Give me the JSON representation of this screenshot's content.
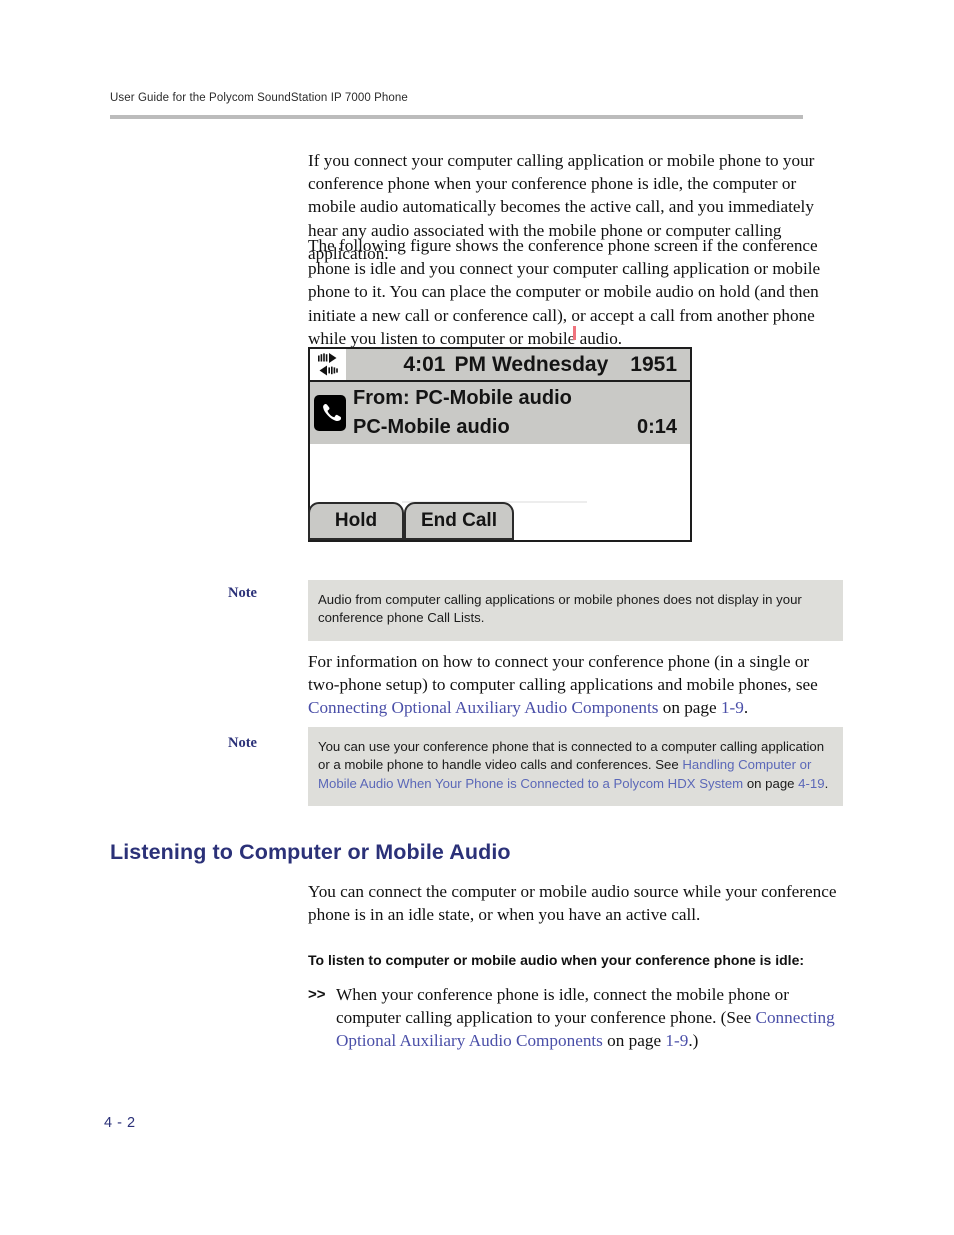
{
  "header": {
    "running_title": "User Guide for the Polycom SoundStation IP 7000 Phone"
  },
  "body": {
    "paragraph_1": "If you connect your computer calling application or mobile phone to your conference phone when your conference phone is idle, the computer or mobile audio automatically becomes the active call, and you immediately hear any audio associated with the mobile phone or computer calling application.",
    "paragraph_2": "The following figure shows the conference phone screen if the conference phone is idle and you connect your computer calling application or mobile phone to it. You can place the computer or mobile audio on hold (and then initiate a new call or conference call), or accept a call from another phone while you listen to computer or mobile audio.",
    "paragraph_3_pre": "For information on how to connect your conference phone (in a single or two-phone setup) to computer calling applications and mobile phones, see ",
    "paragraph_3_link": "Connecting Optional Auxiliary Audio Components",
    "paragraph_3_mid": " on page ",
    "paragraph_3_page": "1-9",
    "paragraph_3_post": ".",
    "paragraph_4": "You can connect the computer or mobile audio source while your conference phone is in an idle state, or when you have an active call."
  },
  "figure": {
    "status_bar": {
      "icon": "speaker-audio-icon",
      "time": "4:01",
      "ampm": "PM",
      "day": "Wednesday",
      "extension": "1951"
    },
    "call": {
      "icon": "handset-icon",
      "from_line": "From: PC-Mobile audio",
      "name_line": "PC-Mobile audio",
      "duration": "0:14"
    },
    "softkeys": [
      {
        "label": "Hold"
      },
      {
        "label": "End Call"
      }
    ]
  },
  "note_1": {
    "label": "Note",
    "text": "Audio from computer calling applications or mobile phones does not display in your conference phone Call Lists."
  },
  "note_2": {
    "label": "Note",
    "text_pre": "You can use your conference phone that is connected to a computer calling application or a mobile phone to handle video calls and conferences. See ",
    "link": "Handling Computer or Mobile Audio When Your Phone is Connected to a Polycom HDX System",
    "text_mid": " on page ",
    "page": "4-19",
    "text_post": "."
  },
  "section": {
    "heading": "Listening to Computer or Mobile Audio"
  },
  "procedure": {
    "heading": "To listen to computer or mobile audio when your conference phone is idle:",
    "marker": ">>",
    "step_pre": "When your conference phone is idle, connect the mobile phone or computer calling application to your conference phone. (See ",
    "step_link": "Connecting Optional Auxiliary Audio Components",
    "step_mid": " on page ",
    "step_page": "1-9",
    "step_post": ".)"
  },
  "footer": {
    "page_number": "4 - 2"
  },
  "colors": {
    "heading_navy": "#2b3178",
    "link_blue": "#4a4fa8",
    "note_background": "#dededa",
    "rule_gray": "#bcbcbc",
    "lcd_gray": "#c9c9c6"
  }
}
